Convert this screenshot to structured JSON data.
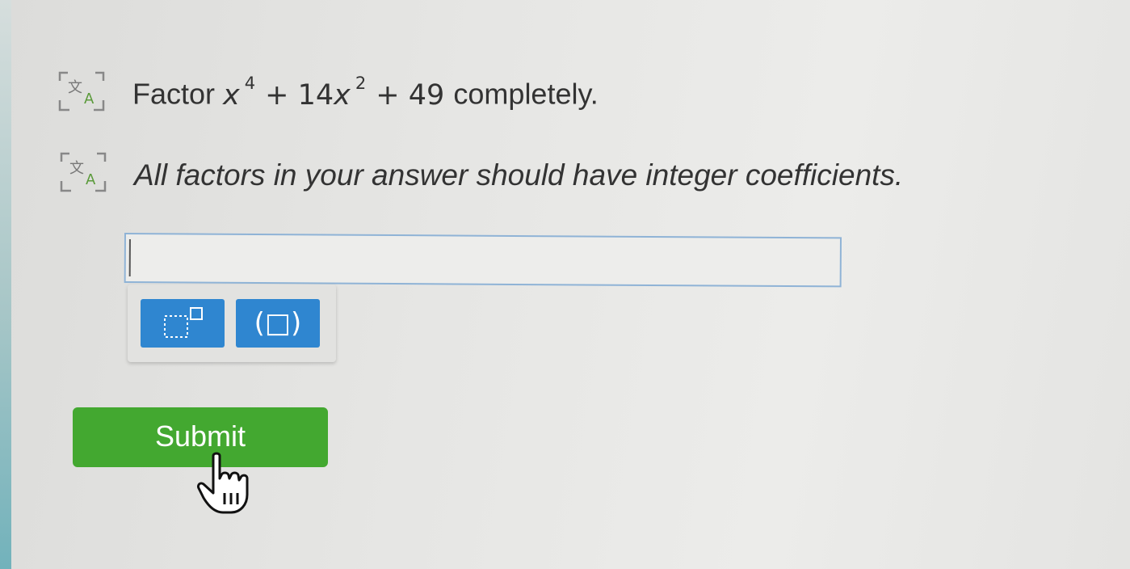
{
  "question": {
    "prefix": "Factor",
    "base1": "x",
    "exp1": "4",
    "op1": "+",
    "coef2": "14",
    "base2": "x",
    "exp2": "2",
    "op2": "+",
    "constant": "49",
    "suffix": "completely."
  },
  "instruction": "All factors in your answer should have integer coefficients.",
  "answer": {
    "value": ""
  },
  "toolbox": {
    "paren_label": "(□)"
  },
  "submit_label": "Submit",
  "colors": {
    "tool_blue": "#2f86d0",
    "submit_green": "#43a830",
    "icon_green": "#5a9a3a",
    "icon_outline": "#777"
  }
}
